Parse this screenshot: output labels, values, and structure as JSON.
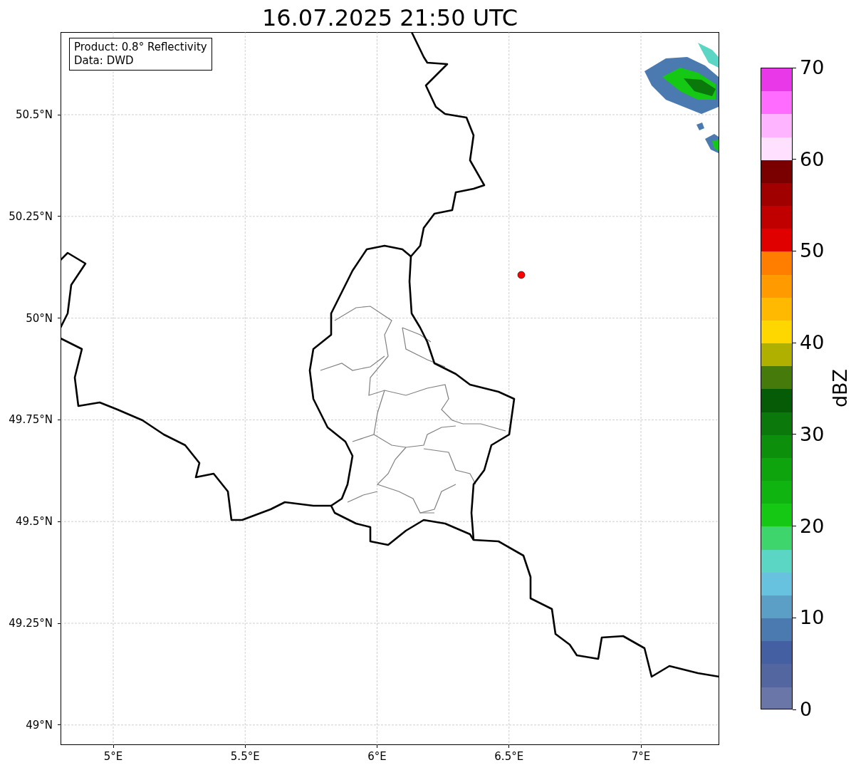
{
  "title": "16.07.2025 21:50 UTC",
  "info_box": {
    "lines": [
      "Product: 0.8° Reflectivity",
      "Data: DWD"
    ]
  },
  "map": {
    "x_ticks": [
      "5°E",
      "5.5°E",
      "6°E",
      "6.5°E",
      "7°E"
    ],
    "y_ticks": [
      "50.5°N",
      "50.25°N",
      "50°N",
      "49.75°N",
      "49.5°N",
      "49.25°N",
      "49°N"
    ]
  },
  "colorbar": {
    "label": "dBZ",
    "ticks": [
      "70",
      "60",
      "50",
      "40",
      "30",
      "20",
      "10",
      "0"
    ],
    "bands": [
      {
        "color": "#e838e8"
      },
      {
        "color": "#ff6cff"
      },
      {
        "color": "#ffb4ff"
      },
      {
        "color": "#ffe0ff"
      },
      {
        "color": "#7a0000"
      },
      {
        "color": "#a00000"
      },
      {
        "color": "#c00000"
      },
      {
        "color": "#e00000"
      },
      {
        "color": "#ff7e00"
      },
      {
        "color": "#ff9a00"
      },
      {
        "color": "#ffb900"
      },
      {
        "color": "#ffd700"
      },
      {
        "color": "#b0b000"
      },
      {
        "color": "#467a0a"
      },
      {
        "color": "#065c06"
      },
      {
        "color": "#0a780a"
      },
      {
        "color": "#0c900c"
      },
      {
        "color": "#0ea40e"
      },
      {
        "color": "#10b410"
      },
      {
        "color": "#14c814"
      },
      {
        "color": "#3ed66c"
      },
      {
        "color": "#5cd6c4"
      },
      {
        "color": "#66c2de"
      },
      {
        "color": "#5b9ec6"
      },
      {
        "color": "#4a7ab0"
      },
      {
        "color": "#4460a2"
      },
      {
        "color": "#5466a0"
      },
      {
        "color": "#6a76a8"
      }
    ]
  }
}
